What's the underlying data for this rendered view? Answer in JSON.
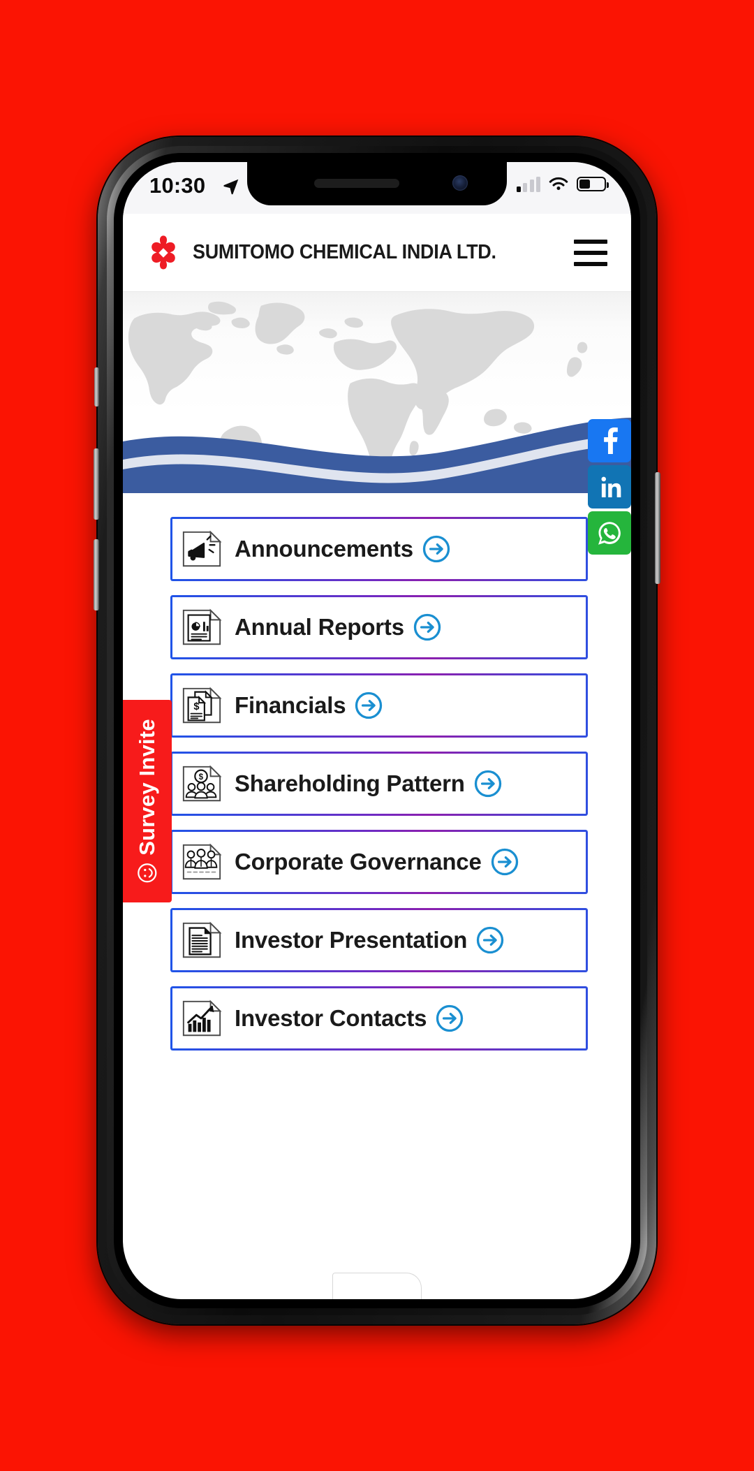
{
  "theme": {
    "page_background": "#FB1403",
    "accent_blue": "#1F54E8",
    "accent_purple": "#8C1FAE",
    "arrow_blue": "#1A8FD1",
    "brand_red": "#EE1C25",
    "survey_red": "#F71B1B",
    "wave_blue": "#3B5CA0"
  },
  "status_bar": {
    "time": "10:30",
    "location_icon": "location-arrow-icon",
    "signal_icon": "cellular-signal-icon",
    "signal_bars_filled": 1,
    "signal_bars_total": 4,
    "wifi_icon": "wifi-icon",
    "battery_icon": "battery-icon",
    "battery_percent": 45
  },
  "header": {
    "logo_icon": "sumitomo-diamond-logo-icon",
    "title": "SUMITOMO CHEMICAL INDIA LTD.",
    "menu_icon": "hamburger-menu-icon"
  },
  "hero": {
    "map_icon": "world-map-graphic",
    "wave_icon": "blue-wave-graphic"
  },
  "social": [
    {
      "name": "facebook",
      "icon": "facebook-icon",
      "glyph": "f",
      "color": "#1877F2"
    },
    {
      "name": "linkedin",
      "icon": "linkedin-icon",
      "glyph": "in",
      "color": "#1174B4"
    },
    {
      "name": "whatsapp",
      "icon": "whatsapp-icon",
      "glyph": "whatsapp",
      "color": "#25B53C"
    }
  ],
  "survey": {
    "label": "Survey Invite",
    "icon": "smiley-face-icon"
  },
  "menu": {
    "arrow_icon": "circle-arrow-right-icon",
    "items": [
      {
        "label": "Announcements",
        "icon": "megaphone-icon"
      },
      {
        "label": "Annual Reports",
        "icon": "report-chart-document-icon"
      },
      {
        "label": "Financials",
        "icon": "dollar-document-icon"
      },
      {
        "label": "Shareholding Pattern",
        "icon": "shareholders-dollar-icon"
      },
      {
        "label": "Corporate Governance",
        "icon": "people-group-document-icon"
      },
      {
        "label": "Investor Presentation",
        "icon": "lined-document-icon"
      },
      {
        "label": "Investor Contacts",
        "icon": "growth-chart-document-icon"
      }
    ]
  }
}
